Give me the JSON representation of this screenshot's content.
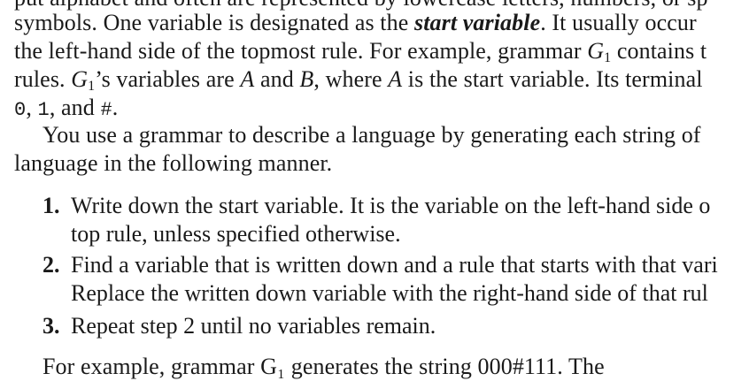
{
  "paragraph1": {
    "line0": "put alphabet and often are represented by lowercase letters, numbers, or sp",
    "line1_a": "symbols. One variable is designated as the ",
    "line1_term": "start variable",
    "line1_b": ". It usually occur",
    "line2_a": "the left-hand side of the topmost rule. For example, grammar ",
    "line2_G": "G",
    "line2_sub": "1",
    "line2_b": " contains t",
    "line3_a": "rules. ",
    "line3_G": "G",
    "line3_sub": "1",
    "line3_b": "’s variables are ",
    "line3_A": "A",
    "line3_c": " and ",
    "line3_B": "B",
    "line3_d": ", where ",
    "line3_A2": "A",
    "line3_e": " is the start variable. Its terminal",
    "line4_t0": "0",
    "line4_c1": ", ",
    "line4_t1": "1",
    "line4_c2": ", and ",
    "line4_t2": "#",
    "line4_end": "."
  },
  "paragraph2": {
    "line0": "You use a grammar to describe a language by generating each string of",
    "line1": "language in the following manner."
  },
  "steps": [
    {
      "number": "1.",
      "line0": "Write down the start variable. It is the variable on the left-hand side o",
      "line1": "top rule, unless specified otherwise."
    },
    {
      "number": "2.",
      "line0": "Find a variable that is written down and a rule that starts with that vari",
      "line1": "Replace the written down variable with the right-hand side of that rul"
    },
    {
      "number": "3.",
      "line0": "Repeat step 2 until no variables remain."
    }
  ],
  "paragraph3": {
    "line0": "For example, grammar G₁ generates the string 000#111. The"
  }
}
